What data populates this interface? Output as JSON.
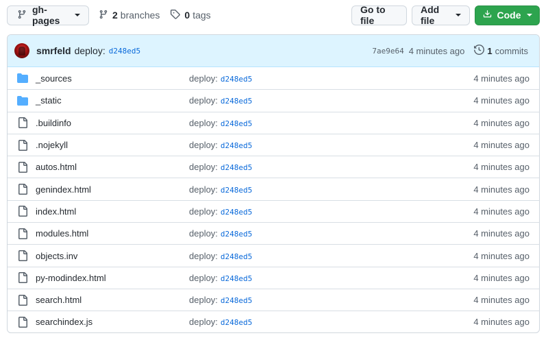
{
  "toolbar": {
    "branch_label": "gh-pages",
    "branches_count": "2",
    "branches_label": "branches",
    "tags_count": "0",
    "tags_label": "tags",
    "goto_label": "Go to file",
    "addfile_label": "Add file",
    "code_label": "Code"
  },
  "commit": {
    "author": "smrfeld",
    "message": "deploy:",
    "message_sha": "d248ed5",
    "sha": "7ae9e64",
    "time": "4 minutes ago",
    "commits_count": "1",
    "commits_label": "commits"
  },
  "colors": {
    "folder": "#54aeff",
    "file": "#57606a",
    "link": "#0969da",
    "code_button": "#2da44e",
    "header_bg": "#ddf4ff"
  },
  "files": [
    {
      "name": "_sources",
      "type": "folder",
      "message": "deploy:",
      "sha": "d248ed5",
      "time": "4 minutes ago"
    },
    {
      "name": "_static",
      "type": "folder",
      "message": "deploy:",
      "sha": "d248ed5",
      "time": "4 minutes ago"
    },
    {
      "name": ".buildinfo",
      "type": "file",
      "message": "deploy:",
      "sha": "d248ed5",
      "time": "4 minutes ago"
    },
    {
      "name": ".nojekyll",
      "type": "file",
      "message": "deploy:",
      "sha": "d248ed5",
      "time": "4 minutes ago"
    },
    {
      "name": "autos.html",
      "type": "file",
      "message": "deploy:",
      "sha": "d248ed5",
      "time": "4 minutes ago"
    },
    {
      "name": "genindex.html",
      "type": "file",
      "message": "deploy:",
      "sha": "d248ed5",
      "time": "4 minutes ago"
    },
    {
      "name": "index.html",
      "type": "file",
      "message": "deploy:",
      "sha": "d248ed5",
      "time": "4 minutes ago"
    },
    {
      "name": "modules.html",
      "type": "file",
      "message": "deploy:",
      "sha": "d248ed5",
      "time": "4 minutes ago"
    },
    {
      "name": "objects.inv",
      "type": "file",
      "message": "deploy:",
      "sha": "d248ed5",
      "time": "4 minutes ago"
    },
    {
      "name": "py-modindex.html",
      "type": "file",
      "message": "deploy:",
      "sha": "d248ed5",
      "time": "4 minutes ago"
    },
    {
      "name": "search.html",
      "type": "file",
      "message": "deploy:",
      "sha": "d248ed5",
      "time": "4 minutes ago"
    },
    {
      "name": "searchindex.js",
      "type": "file",
      "message": "deploy:",
      "sha": "d248ed5",
      "time": "4 minutes ago"
    }
  ]
}
